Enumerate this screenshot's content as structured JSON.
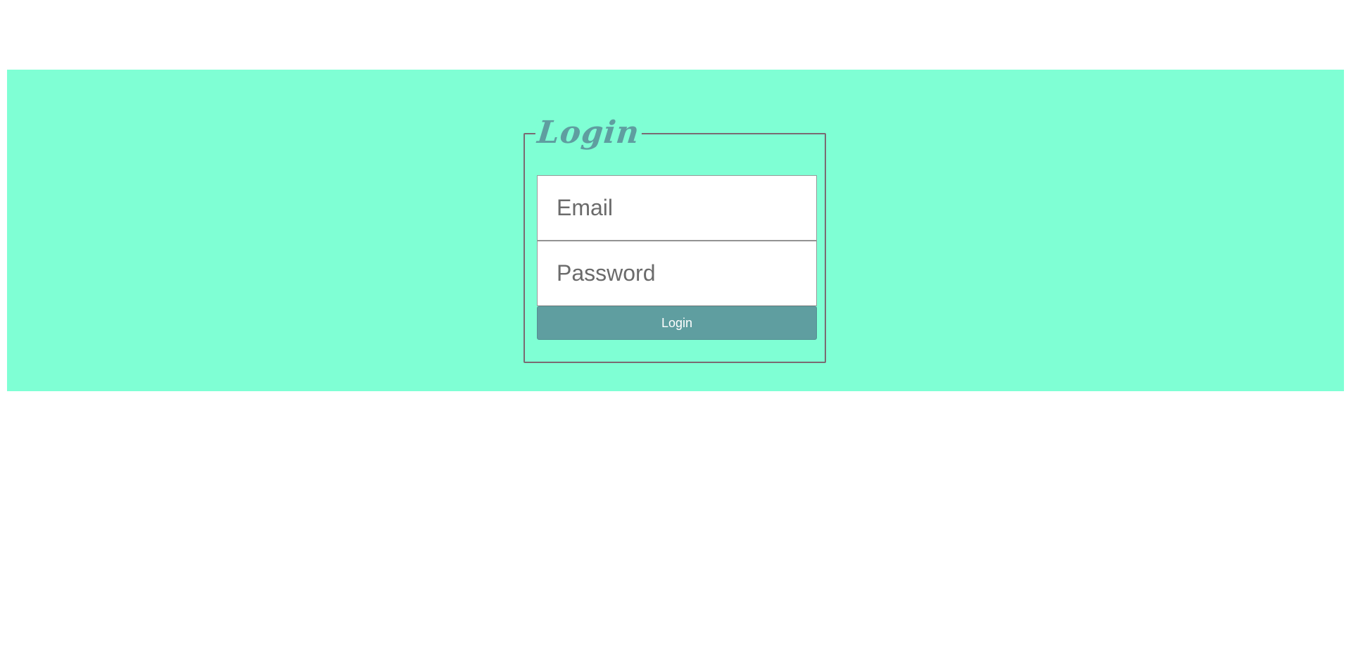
{
  "colors": {
    "banner_background": "#7fffd4",
    "accent": "#5f9ea0",
    "fieldset_border": "#7a6a72",
    "input_text": "#6b6b6b",
    "button_text": "#ffffff"
  },
  "login_form": {
    "legend": "Login",
    "email_placeholder": "Email",
    "password_placeholder": "Password",
    "submit_label": "Login"
  }
}
